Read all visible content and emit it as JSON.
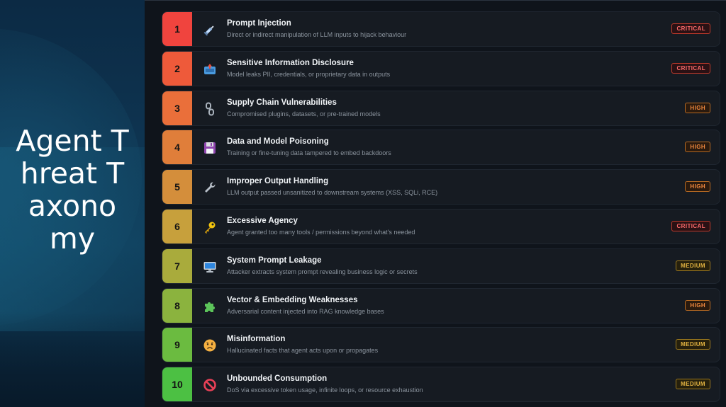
{
  "slide": {
    "title": "Agent Threat Taxonomy"
  },
  "threats": [
    {
      "number": "1",
      "title": "Prompt Injection",
      "description": "Direct or indirect manipulation of LLM inputs to hijack behaviour",
      "severity": "CRITICAL",
      "color": "#f0443e",
      "icon": "syringe-icon"
    },
    {
      "number": "2",
      "title": "Sensitive Information Disclosure",
      "description": "Model leaks PII, credentials, or proprietary data in outputs",
      "severity": "CRITICAL",
      "color": "#ee5a3a",
      "icon": "inbox-icon"
    },
    {
      "number": "3",
      "title": "Supply Chain Vulnerabilities",
      "description": "Compromised plugins, datasets, or pre-trained models",
      "severity": "HIGH",
      "color": "#ea6f3a",
      "icon": "chain-icon"
    },
    {
      "number": "4",
      "title": "Data and Model Poisoning",
      "description": "Training or fine-tuning data tampered to embed backdoors",
      "severity": "HIGH",
      "color": "#e07e3a",
      "icon": "floppy-disk-icon"
    },
    {
      "number": "5",
      "title": "Improper Output Handling",
      "description": "LLM output passed unsanitized to downstream systems (XSS, SQLi, RCE)",
      "severity": "HIGH",
      "color": "#d48e3b",
      "icon": "wrench-icon"
    },
    {
      "number": "6",
      "title": "Excessive Agency",
      "description": "Agent granted too many tools / permissions beyond what's needed",
      "severity": "CRITICAL",
      "color": "#c7a03c",
      "icon": "key-icon"
    },
    {
      "number": "7",
      "title": "System Prompt Leakage",
      "description": "Attacker extracts system prompt revealing business logic or secrets",
      "severity": "MEDIUM",
      "color": "#a9ab3c",
      "icon": "computer-icon"
    },
    {
      "number": "8",
      "title": "Vector & Embedding Weaknesses",
      "description": "Adversarial content injected into RAG knowledge bases",
      "severity": "HIGH",
      "color": "#8bb33e",
      "icon": "puzzle-piece-icon"
    },
    {
      "number": "9",
      "title": "Misinformation",
      "description": "Hallucinated facts that agent acts upon or propagates",
      "severity": "MEDIUM",
      "color": "#6bbb40",
      "icon": "worried-face-icon"
    },
    {
      "number": "10",
      "title": "Unbounded Consumption",
      "description": "DoS via excessive token usage, infinite loops, or resource exhaustion",
      "severity": "MEDIUM",
      "color": "#4cc043",
      "icon": "prohibited-icon"
    }
  ]
}
